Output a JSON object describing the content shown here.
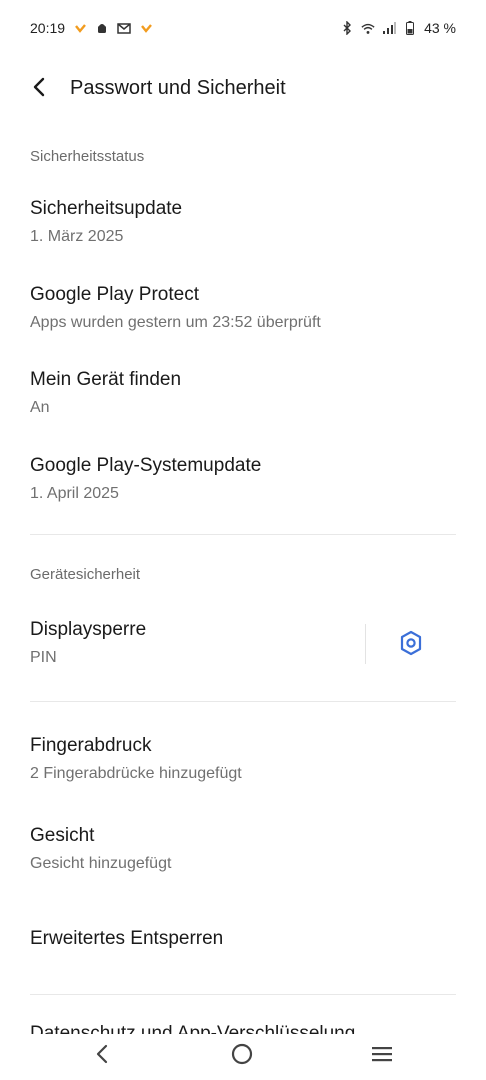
{
  "status_bar": {
    "time": "20:19",
    "battery": "43 %",
    "icons_left": [
      "notification-icon",
      "notification-icon",
      "android-icon",
      "mail-icon",
      "notification-icon"
    ],
    "icons_right": [
      "bluetooth-icon",
      "wifi-icon",
      "signal-icon",
      "battery-icon"
    ]
  },
  "header": {
    "title": "Passwort und Sicherheit",
    "back_icon": "chevron-left-icon"
  },
  "sections": {
    "security_status": {
      "header": "Sicherheitsstatus",
      "items": [
        {
          "title": "Sicherheitsupdate",
          "subtitle": "1. März 2025"
        },
        {
          "title": "Google Play Protect",
          "subtitle": "Apps wurden gestern um 23:52 überprüft"
        },
        {
          "title": "Mein Gerät finden",
          "subtitle": "An"
        },
        {
          "title": "Google Play-Systemupdate",
          "subtitle": "1. April 2025"
        }
      ]
    },
    "device_security": {
      "header": "Gerätesicherheit",
      "items": [
        {
          "title": "Displaysperre",
          "subtitle": "PIN",
          "settings_icon": "gear-icon"
        },
        {
          "title": "Fingerabdruck",
          "subtitle": "2 Fingerabdrücke hinzugefügt"
        },
        {
          "title": "Gesicht",
          "subtitle": "Gesicht hinzugefügt"
        },
        {
          "title": "Erweitertes Entsperren"
        }
      ]
    }
  },
  "partially_visible_item": "Datenschutz und App-Verschlüsselung",
  "nav_bar": {
    "icons": [
      "back-icon",
      "home-icon",
      "recents-icon"
    ]
  },
  "colors": {
    "accent": "#3b6fd8",
    "text_primary": "#1a1a1a",
    "text_secondary": "#707070",
    "divider": "#e8e8e8"
  }
}
